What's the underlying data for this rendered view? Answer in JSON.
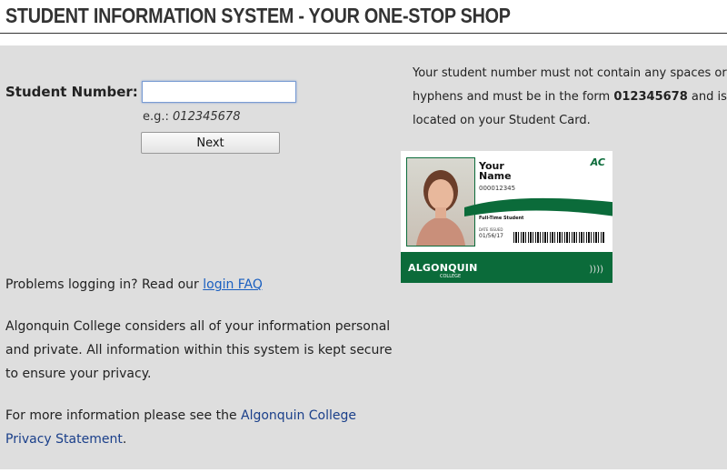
{
  "header": {
    "title": "STUDENT INFORMATION SYSTEM - YOUR ONE-STOP SHOP"
  },
  "form": {
    "label": "Student Number:",
    "input_value": "",
    "example_prefix": "e.g.: ",
    "example_value": "012345678",
    "next_label": "Next"
  },
  "help": {
    "part1": "Your student number must not contain any spaces or hyphens and must be in the form ",
    "format": "012345678",
    "part2": " and is located on your Student Card."
  },
  "card": {
    "name_line1": "Your",
    "name_line2": "Name",
    "id": "000012345",
    "ac_mark": "AC",
    "status": "Full-Time Student",
    "date_label": "DATE ISSUED",
    "date": "01/56/17",
    "logo": "ALGONQUIN",
    "logo_sub": "COLLEGE",
    "contactless": "))))"
  },
  "problems": {
    "text": "Problems logging in? Read our ",
    "link": "login FAQ"
  },
  "privacy_note": "Algonquin College considers all of your information personal and private. All information within this system is kept secure to ensure your privacy.",
  "more_info": {
    "text": "For more information please see the ",
    "link": "Algonquin College Privacy Statement",
    "end": "."
  },
  "colors": {
    "panel": "#dedede",
    "brand_green": "#0b6b3a",
    "link": "#1a5fc0"
  }
}
